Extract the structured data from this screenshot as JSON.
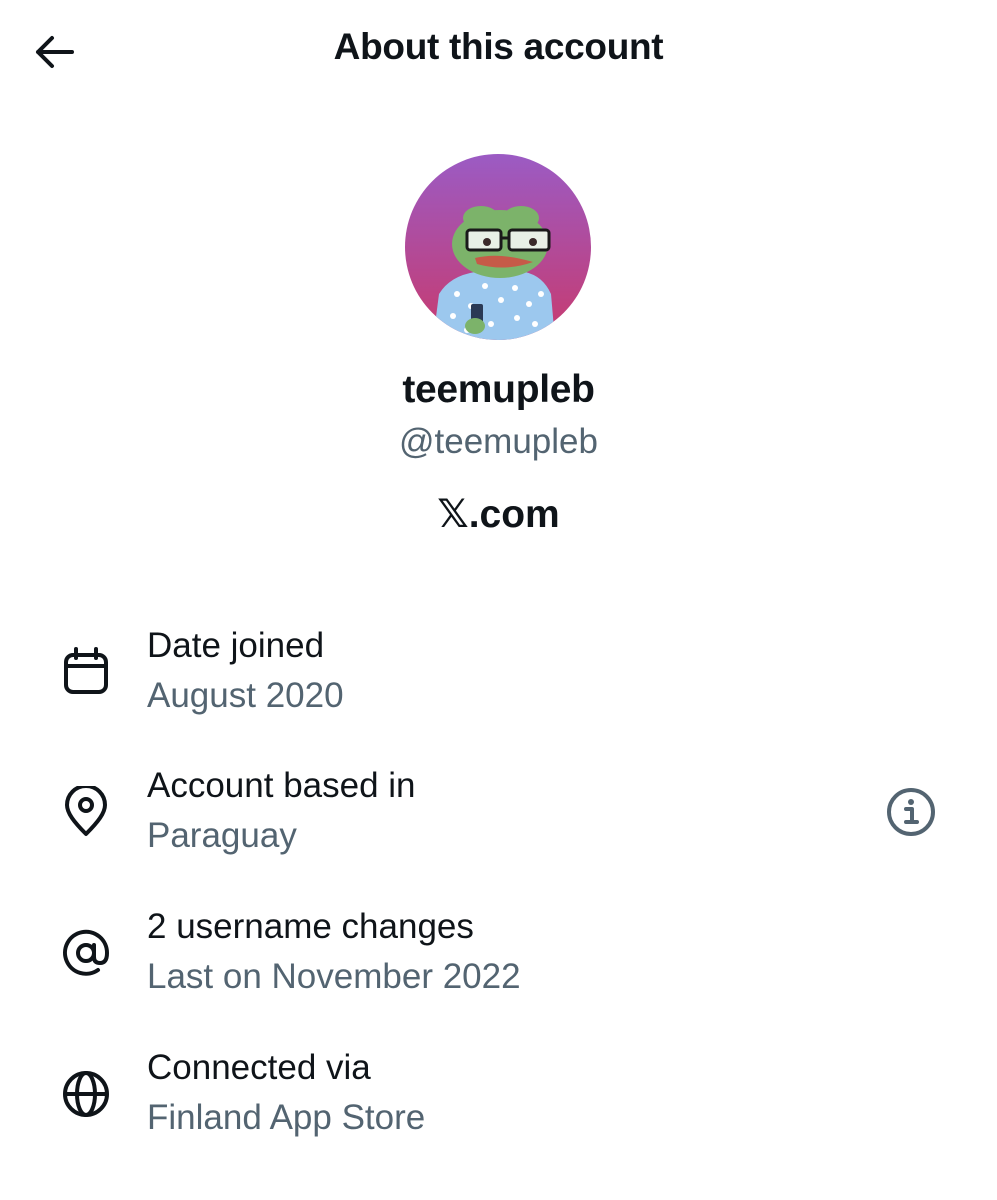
{
  "header": {
    "title": "About this account",
    "back_icon": "arrow-left-icon"
  },
  "profile": {
    "display_name": "teemupleb",
    "handle": "@teemupleb",
    "platform_logo": "𝕏",
    "platform_suffix": ".com"
  },
  "details": [
    {
      "icon": "calendar-icon",
      "title": "Date joined",
      "value": "August 2020"
    },
    {
      "icon": "location-pin-icon",
      "title": "Account based in",
      "value": "Paraguay",
      "info_icon": "info-icon"
    },
    {
      "icon": "at-sign-icon",
      "title": "2 username changes",
      "value": "Last on November 2022"
    },
    {
      "icon": "globe-icon",
      "title": "Connected via",
      "value": "Finland App Store"
    }
  ],
  "colors": {
    "text_primary": "#0f1419",
    "text_secondary": "#536471",
    "avatar_gradient_top": "#9b5bc4",
    "avatar_gradient_bottom": "#c83a6e"
  }
}
